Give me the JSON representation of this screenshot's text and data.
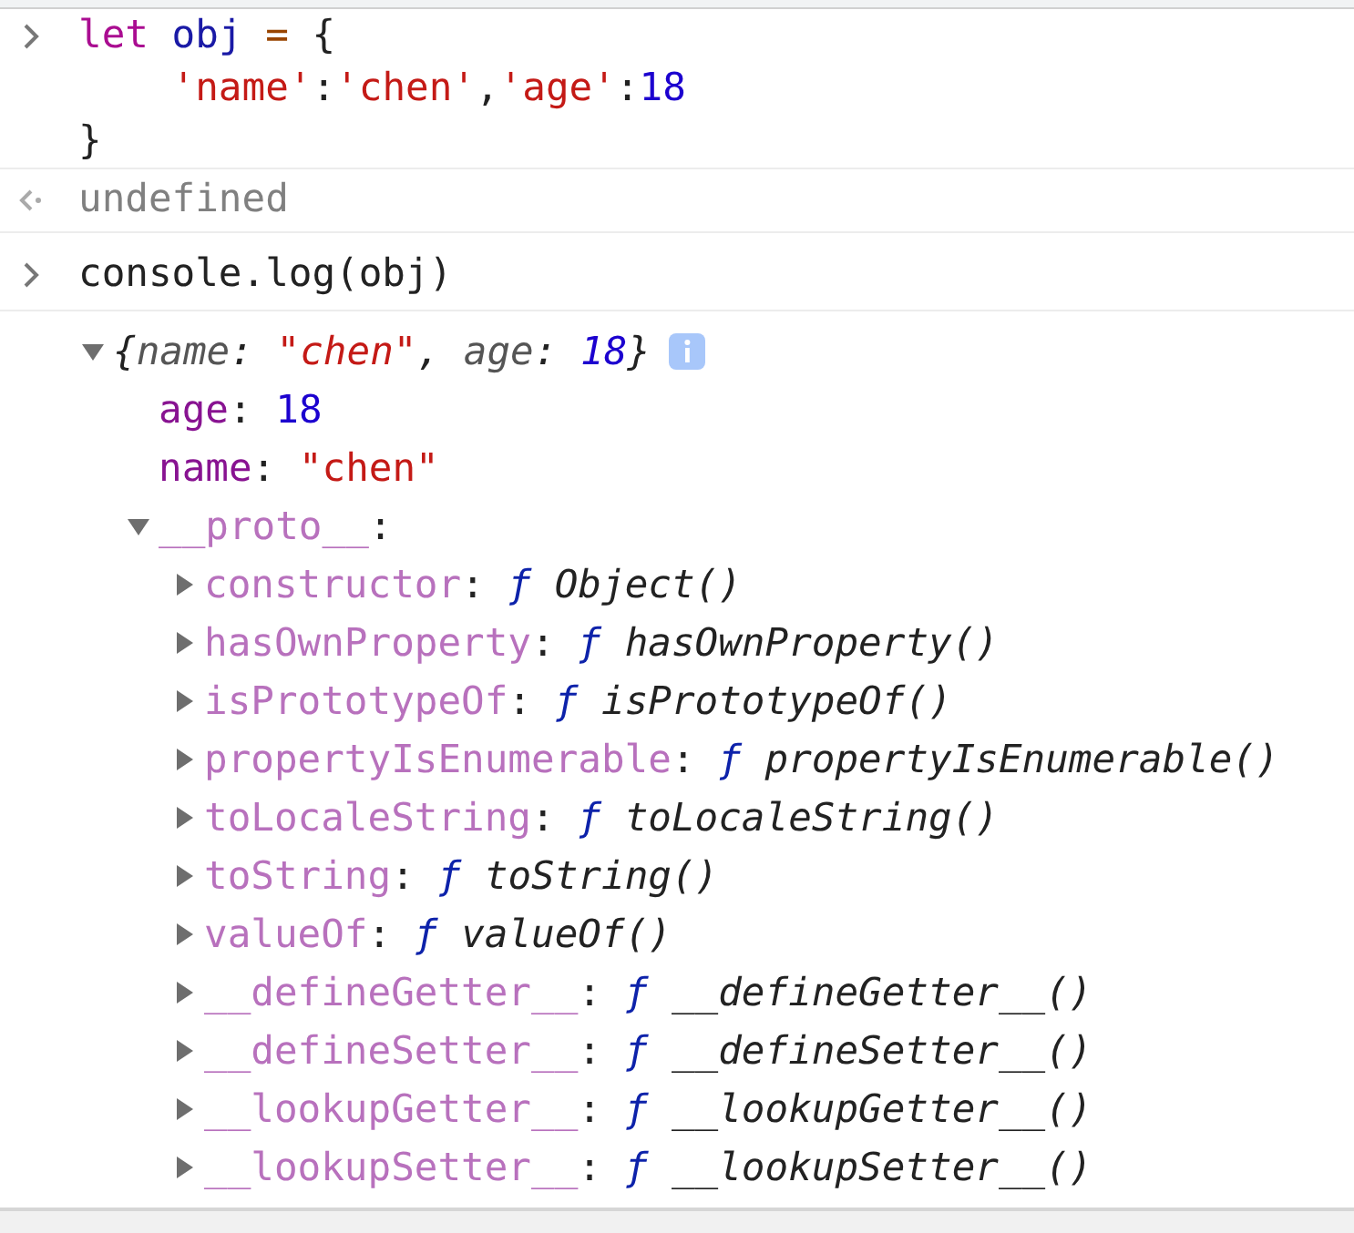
{
  "console": {
    "entries": [
      {
        "kind": "input",
        "lines": [
          {
            "kind": "first",
            "tokens": [
              {
                "kind": "keyword",
                "text": "let "
              },
              {
                "kind": "variable",
                "text": "obj "
              },
              {
                "kind": "operator",
                "text": "= "
              },
              {
                "kind": "punct",
                "text": "{"
              }
            ]
          },
          {
            "kind": "continuation",
            "tokens": [
              {
                "kind": "string",
                "text": "'name'"
              },
              {
                "kind": "punct",
                "text": ":"
              },
              {
                "kind": "string",
                "text": "'chen'"
              },
              {
                "kind": "punct",
                "text": ","
              },
              {
                "kind": "string",
                "text": "'age'"
              },
              {
                "kind": "punct",
                "text": ":"
              },
              {
                "kind": "number",
                "text": "18"
              }
            ]
          },
          {
            "kind": "first",
            "tokens": [
              {
                "kind": "punct",
                "text": "}"
              }
            ]
          }
        ]
      },
      {
        "kind": "result",
        "text": "undefined"
      },
      {
        "kind": "input",
        "lines": [
          {
            "kind": "first",
            "tokens": [
              {
                "kind": "punct",
                "text": "console.log(obj)"
              }
            ]
          }
        ]
      },
      {
        "kind": "log",
        "tree": {
          "expanded": true,
          "summary": [
            {
              "kind": "punct",
              "text": "{"
            },
            {
              "kind": "key",
              "text": "name"
            },
            {
              "kind": "punct",
              "text": ": "
            },
            {
              "kind": "string",
              "text": "\"chen\""
            },
            {
              "kind": "punct",
              "text": ", "
            },
            {
              "kind": "key",
              "text": "age"
            },
            {
              "kind": "punct",
              "text": ": "
            },
            {
              "kind": "number",
              "text": "18"
            },
            {
              "kind": "punct",
              "text": "}"
            }
          ],
          "children": [
            {
              "key": "age",
              "colon": ":",
              "inherited": false,
              "value": {
                "kind": "number",
                "text": "18"
              }
            },
            {
              "key": "name",
              "colon": ":",
              "inherited": false,
              "value": {
                "kind": "string",
                "text": "\"chen\""
              }
            },
            {
              "key": "__proto__",
              "colon": ":",
              "inherited": true,
              "expanded": true,
              "children": [
                {
                  "key": "constructor",
                  "colon": ":",
                  "inherited": true,
                  "expanded": false,
                  "value": {
                    "kind": "function",
                    "sign": "ƒ",
                    "text": "Object()"
                  }
                },
                {
                  "key": "hasOwnProperty",
                  "colon": ":",
                  "inherited": true,
                  "expanded": false,
                  "value": {
                    "kind": "function",
                    "sign": "ƒ",
                    "text": "hasOwnProperty()"
                  }
                },
                {
                  "key": "isPrototypeOf",
                  "colon": ":",
                  "inherited": true,
                  "expanded": false,
                  "value": {
                    "kind": "function",
                    "sign": "ƒ",
                    "text": "isPrototypeOf()"
                  }
                },
                {
                  "key": "propertyIsEnumerable",
                  "colon": ":",
                  "inherited": true,
                  "expanded": false,
                  "value": {
                    "kind": "function",
                    "sign": "ƒ",
                    "text": "propertyIsEnumerable()"
                  }
                },
                {
                  "key": "toLocaleString",
                  "colon": ":",
                  "inherited": true,
                  "expanded": false,
                  "value": {
                    "kind": "function",
                    "sign": "ƒ",
                    "text": "toLocaleString()"
                  }
                },
                {
                  "key": "toString",
                  "colon": ":",
                  "inherited": true,
                  "expanded": false,
                  "value": {
                    "kind": "function",
                    "sign": "ƒ",
                    "text": "toString()"
                  }
                },
                {
                  "key": "valueOf",
                  "colon": ":",
                  "inherited": true,
                  "expanded": false,
                  "value": {
                    "kind": "function",
                    "sign": "ƒ",
                    "text": "valueOf()"
                  }
                },
                {
                  "key": "__defineGetter__",
                  "colon": ":",
                  "inherited": true,
                  "expanded": false,
                  "value": {
                    "kind": "function",
                    "sign": "ƒ",
                    "text": "__defineGetter__()"
                  }
                },
                {
                  "key": "__defineSetter__",
                  "colon": ":",
                  "inherited": true,
                  "expanded": false,
                  "value": {
                    "kind": "function",
                    "sign": "ƒ",
                    "text": "__defineSetter__()"
                  }
                },
                {
                  "key": "__lookupGetter__",
                  "colon": ":",
                  "inherited": true,
                  "expanded": false,
                  "value": {
                    "kind": "function",
                    "sign": "ƒ",
                    "text": "__lookupGetter__()"
                  }
                },
                {
                  "key": "__lookupSetter__",
                  "colon": ":",
                  "inherited": true,
                  "expanded": false,
                  "value": {
                    "kind": "function",
                    "sign": "ƒ",
                    "text": "__lookupSetter__()"
                  }
                }
              ]
            }
          ]
        }
      }
    ]
  }
}
